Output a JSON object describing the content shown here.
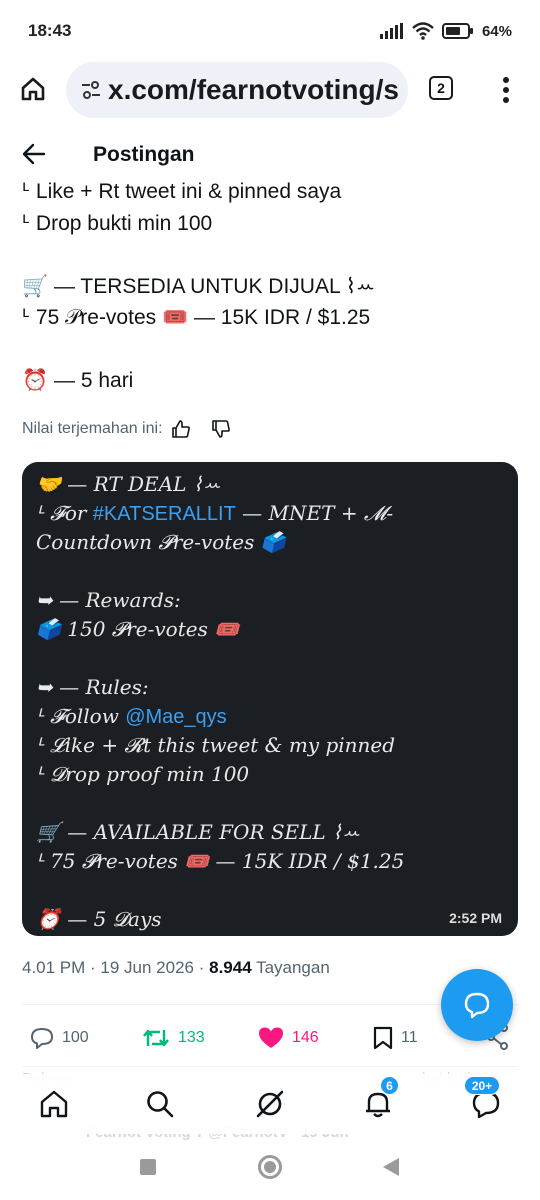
{
  "status_bar": {
    "time": "18:43",
    "battery": "64%"
  },
  "browser": {
    "url": "x.com/fearnotvoting/s",
    "tab_count": "2"
  },
  "header": {
    "title": "Postingan"
  },
  "tweet": {
    "lines": [
      "ᒻ Like + Rt tweet ini & pinned saya",
      "ᒻ Drop bukti min 100",
      "",
      "🛒 — TERSEDIA UNTUK DIJUAL ⌇ꕀ",
      "ᒻ 75 𝒫re-votes 🎟️ — 15K IDR / $1.25",
      "",
      "⏰ — 5 hari"
    ],
    "rate_label": "Nilai terjemahan ini:"
  },
  "media": {
    "lines": [
      {
        "pre": "🤝 — RT DEAL ⌇ꕀ",
        "blue": "",
        "post": ""
      },
      {
        "pre": "ᒻ 𝓕or ",
        "blue": "#KATSERALLIT",
        "post": " — MNET + 𝓜-"
      },
      {
        "pre": "Countdown 𝓟re-votes 🗳️",
        "blue": "",
        "post": ""
      },
      {
        "pre": "",
        "blue": "",
        "post": ""
      },
      {
        "pre": "➥ — Rewards:",
        "blue": "",
        "post": ""
      },
      {
        "pre": "🗳️ 150 𝓟re-votes 🎟️",
        "blue": "",
        "post": ""
      },
      {
        "pre": "",
        "blue": "",
        "post": ""
      },
      {
        "pre": "➥ — Rules:",
        "blue": "",
        "post": ""
      },
      {
        "pre": "ᒻ 𝓕ollow ",
        "blue": "@Mae_qys",
        "post": ""
      },
      {
        "pre": "ᒻ 𝓛ike + 𝓡t this tweet & my pinned",
        "blue": "",
        "post": ""
      },
      {
        "pre": "ᒻ 𝓓rop proof min 100",
        "blue": "",
        "post": ""
      },
      {
        "pre": "",
        "blue": "",
        "post": ""
      },
      {
        "pre": "🛒 — AVAILABLE FOR SELL ⌇ꕀ",
        "blue": "",
        "post": ""
      },
      {
        "pre": "ᒻ 75 𝓟re-votes 🎟️ — 15K IDR / $1.25",
        "blue": "",
        "post": ""
      },
      {
        "pre": "",
        "blue": "",
        "post": ""
      },
      {
        "pre": "⏰ — 5 𝓓ays",
        "blue": "",
        "post": ""
      }
    ],
    "timestamp": "2:52 PM"
  },
  "meta": {
    "time": "4.01 PM · 19 Jun 2026 · ",
    "views_count": "8.944",
    "views_label": " Tayangan"
  },
  "actions": {
    "replies": "100",
    "retweets": "133",
    "likes": "146",
    "bookmarks": "11"
  },
  "ghost": {
    "relevant": "Relevan",
    "right": "hat kutipan",
    "reply_preview": "Fearnot Voting T   @FearnotV · 19 Jun"
  },
  "tabbar": {
    "notif_badge": "6",
    "msg_badge": "20+"
  },
  "colors": {
    "accent": "#1d9bf0",
    "retweet": "#00ba7c",
    "like": "#f91880"
  }
}
